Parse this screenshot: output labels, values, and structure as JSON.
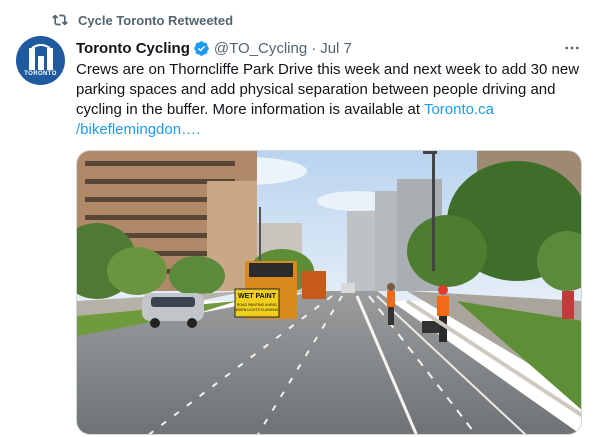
{
  "retweet": {
    "icon": "retweet-icon",
    "label": "Cycle Toronto Retweeted"
  },
  "author": {
    "avatar_icon": "city-of-toronto-logo",
    "avatar_text": "TORONTO",
    "display_name": "Toronto Cycling",
    "verified_icon": "verified-badge-icon",
    "handle": "@TO_Cycling",
    "separator": "·",
    "date": "Jul 7"
  },
  "more_icon": "more-options-icon",
  "tweet": {
    "text": "Crews are on Thorncliffe Park Drive this week and next week to add 30 new parking spaces and add physical separation between people driving and cycling in the buffer. More information is available at ",
    "link_line1": "Toronto.ca",
    "link_line2": "/bikeflemingdon…."
  },
  "media": {
    "description_icon": "street-photo",
    "sign_line1": "WET PAINT",
    "sign_line2": "ROAD PAINTING AHEAD",
    "sign_line3": "WHEN LIGHTS FLASHING"
  },
  "colors": {
    "link": "#1d9bf0",
    "secondary_text": "#536471",
    "verified": "#1d9bf0",
    "avatar_bg": "#1f5aa0"
  }
}
